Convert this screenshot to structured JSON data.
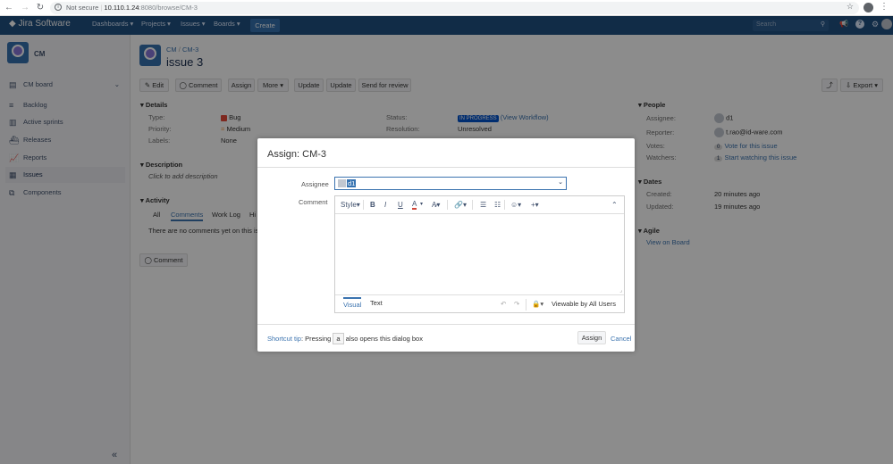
{
  "browser": {
    "not_secure": "Not secure",
    "url_host": "10.110.1.24",
    "url_path": ":8080/browse/CM-3"
  },
  "header": {
    "logo": "Jira Software",
    "menus": [
      "Dashboards",
      "Projects",
      "Issues",
      "Boards"
    ],
    "create": "Create",
    "search_placeholder": "Search"
  },
  "sidebar": {
    "project_name": "CM",
    "board_label": "CM board",
    "items": [
      "Backlog",
      "Active sprints",
      "Releases",
      "Reports",
      "Issues",
      "Components"
    ]
  },
  "issue": {
    "breadcrumb_project": "CM",
    "breadcrumb_key": "CM-3",
    "title": "issue 3",
    "actions": {
      "edit": "Edit",
      "comment": "Comment",
      "assign": "Assign",
      "more": "More",
      "update1": "Update",
      "update2": "Update",
      "send_review": "Send for review",
      "export": "Export"
    },
    "details": {
      "heading": "Details",
      "type_label": "Type:",
      "type_value": "Bug",
      "priority_label": "Priority:",
      "priority_value": "Medium",
      "labels_label": "Labels:",
      "labels_value": "None",
      "status_label": "Status:",
      "status_value": "IN PROGRESS",
      "view_workflow": "(View Workflow)",
      "resolution_label": "Resolution:",
      "resolution_value": "Unresolved"
    },
    "description": {
      "heading": "Description",
      "placeholder": "Click to add description"
    },
    "activity": {
      "heading": "Activity",
      "tabs": [
        "All",
        "Comments",
        "Work Log",
        "Hi"
      ],
      "empty": "There are no comments yet on this iss",
      "comment_button": "Comment"
    },
    "people": {
      "heading": "People",
      "assignee_label": "Assignee:",
      "assignee_value": "d1",
      "reporter_label": "Reporter:",
      "reporter_value": "t.rao@id-ware.com",
      "votes_label": "Votes:",
      "votes_count": "0",
      "votes_link": "Vote for this issue",
      "watchers_label": "Watchers:",
      "watchers_count": "1",
      "watchers_link": "Start watching this issue"
    },
    "dates": {
      "heading": "Dates",
      "created_label": "Created:",
      "created_value": "20 minutes ago",
      "updated_label": "Updated:",
      "updated_value": "19 minutes ago"
    },
    "agile": {
      "heading": "Agile",
      "view_board": "View on Board"
    }
  },
  "dialog": {
    "title": "Assign: CM-3",
    "assignee_label": "Assignee",
    "assignee_value": "d1",
    "comment_label": "Comment",
    "toolbar_style": "Style",
    "tab_visual": "Visual",
    "tab_text": "Text",
    "viewable": "Viewable by All Users",
    "tip_link": "Shortcut tip",
    "tip_text1": ": Pressing",
    "tip_key": "a",
    "tip_text2": "also opens this dialog box",
    "assign_button": "Assign",
    "cancel_link": "Cancel"
  }
}
